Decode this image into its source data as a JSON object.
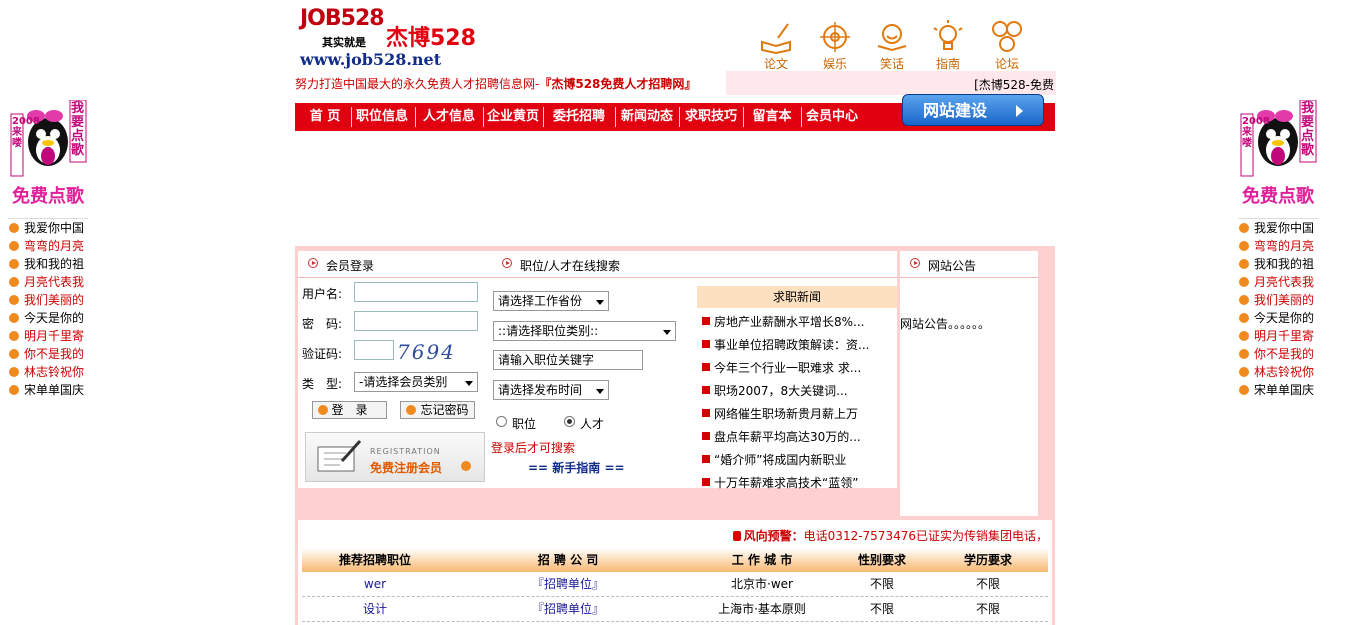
{
  "logo": {
    "brand": "JOB528",
    "brand_cn": "杰博528",
    "tagline": "其实就是",
    "url": "www.job528.net"
  },
  "top_nav": [
    {
      "label": "论文",
      "icon": "book-pen-icon"
    },
    {
      "label": "娱乐",
      "icon": "target-icon"
    },
    {
      "label": "笑话",
      "icon": "smile-icon"
    },
    {
      "label": "指南",
      "icon": "lightbulb-icon"
    },
    {
      "label": "论坛",
      "icon": "faces-icon"
    }
  ],
  "slogan": {
    "prefix": "努力打造中国最大的永久免费人才招聘信息网-",
    "highlight": "『杰博528免费人才招聘网』"
  },
  "marquee": "[杰博528-免费",
  "main_nav": [
    "首 页",
    "职位信息",
    "人才信息",
    "企业黄页",
    "委托招聘",
    "新闻动态",
    "求职技巧",
    "留言本",
    "会员中心"
  ],
  "build_button": "网站建设",
  "side_widget": {
    "badge_year": "2008来喽",
    "badge_side": "我要点歌",
    "title": "免费点歌",
    "songs": [
      "我爱你中国",
      "弯弯的月亮",
      "我和我的祖",
      "月亮代表我",
      "我们美丽的",
      "今天是你的",
      "明月千里寄",
      "你不是我的",
      "林志铃祝你",
      "宋单单国庆"
    ]
  },
  "login": {
    "header": "会员登录",
    "username_label": "用户名:",
    "password_label": "密　码:",
    "captcha_label": "验证码:",
    "captcha_value": "7694",
    "type_label": "类　型:",
    "type_select": "-请选择会员类别",
    "login_button": "登　录",
    "forgot_button": "忘记密码",
    "reg_small": "REGISTRATION",
    "reg_big": "免费注册会员"
  },
  "search": {
    "header": "职位/人才在线搜索",
    "province_select": "请选择工作省份",
    "category_select": "::请选择职位类别::",
    "keyword_placeholder": "请输入职位关键字",
    "time_select": "请选择发布时间",
    "radio_job": "职位",
    "radio_talent": "人才",
    "login_note": "登录后才可搜索",
    "guide": "== 新手指南 =="
  },
  "news": {
    "header": "求职新闻",
    "items": [
      "房地产业薪酬水平增长8%...",
      "事业单位招聘政策解读：资...",
      "今年三个行业一职难求 求...",
      "职场2007，8大关键词...",
      "网络催生职场新贵月薪上万",
      "盘点年薪平均高达30万的...",
      "“婚介师”将成国内新职业",
      "十万年薪难求高技术“蓝领”"
    ]
  },
  "notice": {
    "header": "网站公告",
    "content": "网站公告。。。。。。"
  },
  "warning": {
    "label": "风向预警：",
    "text": "电话0312-7573476已证实为传销集团电话，"
  },
  "table": {
    "headers": [
      "推荐招聘职位",
      "招 聘 公 司",
      "工 作 城 市",
      "性别要求",
      "学历要求"
    ],
    "rows": [
      [
        "wer",
        "『招聘单位』",
        "北京市·wer",
        "不限",
        "不限"
      ],
      [
        "设计",
        "『招聘单位』",
        "上海市·基本原则",
        "不限",
        "不限"
      ]
    ]
  }
}
